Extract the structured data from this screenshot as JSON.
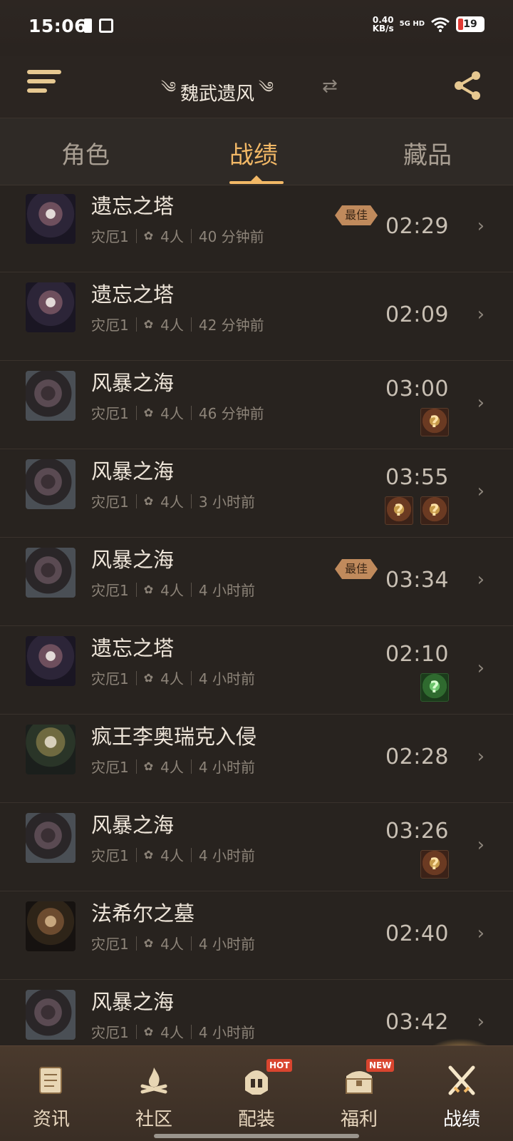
{
  "status": {
    "time": "15:06",
    "speed": "0.40\nKB/s",
    "net": "5G HD",
    "battery": "19"
  },
  "header": {
    "title": "魏武遗风"
  },
  "tabs": [
    {
      "label": "角色"
    },
    {
      "label": "战绩"
    },
    {
      "label": "藏品"
    }
  ],
  "records": [
    {
      "name": "遗忘之塔",
      "difficulty": "灾厄1",
      "players": "4人",
      "ago": "40 分钟前",
      "time": "02:29",
      "best": "最佳",
      "thumb": "tower",
      "drops": []
    },
    {
      "name": "遗忘之塔",
      "difficulty": "灾厄1",
      "players": "4人",
      "ago": "42 分钟前",
      "time": "02:09",
      "best": "",
      "thumb": "tower",
      "drops": []
    },
    {
      "name": "风暴之海",
      "difficulty": "灾厄1",
      "players": "4人",
      "ago": "46 分钟前",
      "time": "03:00",
      "best": "",
      "thumb": "storm",
      "drops": [
        "orange"
      ]
    },
    {
      "name": "风暴之海",
      "difficulty": "灾厄1",
      "players": "4人",
      "ago": "3 小时前",
      "time": "03:55",
      "best": "",
      "thumb": "storm",
      "drops": [
        "orange",
        "orange"
      ]
    },
    {
      "name": "风暴之海",
      "difficulty": "灾厄1",
      "players": "4人",
      "ago": "4 小时前",
      "time": "03:34",
      "best": "最佳",
      "thumb": "storm",
      "drops": []
    },
    {
      "name": "遗忘之塔",
      "difficulty": "灾厄1",
      "players": "4人",
      "ago": "4 小时前",
      "time": "02:10",
      "best": "",
      "thumb": "tower",
      "drops": [
        "green"
      ]
    },
    {
      "name": "疯王李奥瑞克入侵",
      "difficulty": "灾厄1",
      "players": "4人",
      "ago": "4 小时前",
      "time": "02:28",
      "best": "",
      "thumb": "king",
      "drops": []
    },
    {
      "name": "风暴之海",
      "difficulty": "灾厄1",
      "players": "4人",
      "ago": "4 小时前",
      "time": "03:26",
      "best": "",
      "thumb": "storm",
      "drops": [
        "orange"
      ]
    },
    {
      "name": "法希尔之墓",
      "difficulty": "灾厄1",
      "players": "4人",
      "ago": "4 小时前",
      "time": "02:40",
      "best": "",
      "thumb": "tomb",
      "drops": []
    },
    {
      "name": "风暴之海",
      "difficulty": "灾厄1",
      "players": "4人",
      "ago": "4 小时前",
      "time": "03:42",
      "best": "",
      "thumb": "storm",
      "drops": []
    }
  ],
  "nav": [
    {
      "label": "资讯",
      "icon": "scroll-icon",
      "tag": ""
    },
    {
      "label": "社区",
      "icon": "campfire-icon",
      "tag": ""
    },
    {
      "label": "配装",
      "icon": "helmet-icon",
      "tag": "HOT"
    },
    {
      "label": "福利",
      "icon": "chest-icon",
      "tag": "NEW"
    },
    {
      "label": "战绩",
      "icon": "crossed-swords-icon",
      "tag": ""
    }
  ],
  "colors": {
    "accent": "#f2b866",
    "background": "#28231f",
    "best_badge": "#c08a5c"
  }
}
